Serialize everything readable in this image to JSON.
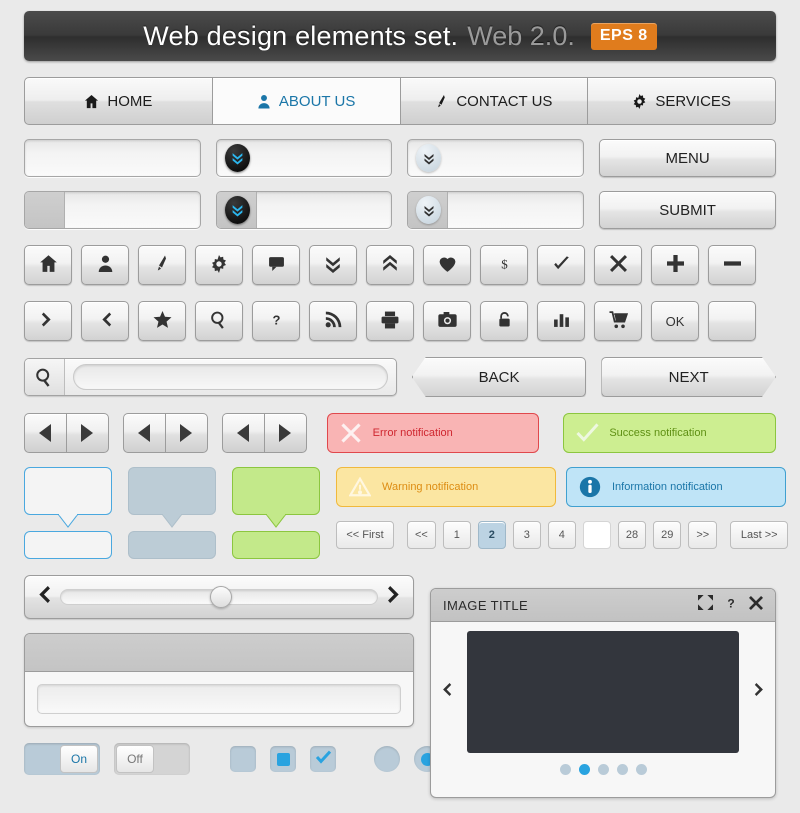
{
  "header": {
    "title": "Web design elements set.",
    "subtitle": "Web 2.0.",
    "badge": "EPS 8",
    "badge_color": "#e07c1d"
  },
  "nav": {
    "items": [
      {
        "label": "HOME",
        "icon": "home-icon",
        "active": false
      },
      {
        "label": "ABOUT US",
        "icon": "user-icon",
        "active": true
      },
      {
        "label": "CONTACT US",
        "icon": "pencil-icon",
        "active": false
      },
      {
        "label": "SERVICES",
        "icon": "gear-icon",
        "active": false
      }
    ],
    "active_color": "#1b76a8"
  },
  "inputs": {
    "row1": {
      "plain_value": "",
      "dark_badge_icon": "double-chevron-down-icon",
      "light_badge_icon": "double-chevron-down-icon",
      "button_label": "MENU"
    },
    "row2": {
      "plain_value": "",
      "dark_badge_icon": "double-chevron-down-icon",
      "light_badge_icon": "double-chevron-down-icon",
      "button_label": "SUBMIT"
    }
  },
  "icon_grid": {
    "row1": [
      "home-icon",
      "user-icon",
      "pencil-icon",
      "gear-icon",
      "comment-icon",
      "double-chevron-down-icon",
      "double-chevron-up-icon",
      "heart-icon",
      "dollar-icon",
      "check-icon",
      "close-icon",
      "plus-icon",
      "minus-icon"
    ],
    "row2": [
      "chevron-right-icon",
      "chevron-left-icon",
      "star-icon",
      "magnifier-icon",
      "question-icon",
      "rss-icon",
      "printer-icon",
      "camera-icon",
      "lock-icon",
      "bar-chart-icon",
      "cart-icon",
      "ok-text-icon",
      "blank-icon"
    ],
    "ok_label": "OK"
  },
  "search": {
    "icon": "magnifier-icon",
    "value": "",
    "placeholder": ""
  },
  "arrow_buttons": {
    "back_label": "BACK",
    "next_label": "NEXT"
  },
  "notifications": [
    {
      "type": "error",
      "label": "Error notification",
      "icon": "x-circle-icon",
      "bg": "#f9b4b4",
      "border": "#e0484c",
      "text": "#cf2730"
    },
    {
      "type": "success",
      "label": "Success notification",
      "icon": "check-icon",
      "bg": "#cdee91",
      "border": "#8cc63f",
      "text": "#5f9014"
    },
    {
      "type": "warning",
      "label": "Warning notification",
      "icon": "warning-triangle-icon",
      "bg": "#fbe6a2",
      "border": "#f0b93c",
      "text": "#dd8d13"
    },
    {
      "type": "info",
      "label": "Information notification",
      "icon": "info-circle-icon",
      "bg": "#bfe4f7",
      "border": "#40a0d0",
      "text": "#1b76a8"
    }
  ],
  "bubbles": [
    {
      "style": "white",
      "body_bg": "#f4f4f4",
      "border": "#4aa8df"
    },
    {
      "style": "gray",
      "body_bg": "#bcccd6",
      "border": "#aebfca"
    },
    {
      "style": "green",
      "body_bg": "#c3e98a",
      "border": "#8cc63f"
    }
  ],
  "pagination": {
    "first_label": "<< First",
    "prev_label": "<<",
    "pages": [
      "1",
      "2",
      "3",
      "4",
      "",
      "28",
      "29"
    ],
    "active_page": "2",
    "next_label": ">>",
    "last_label": "Last >>",
    "active_color": "#bcd3e3"
  },
  "slider": {
    "left_icon": "chevron-left-icon",
    "right_icon": "chevron-right-icon",
    "value_percent": 47
  },
  "panel": {
    "input_value": "",
    "input_placeholder": ""
  },
  "toggles": [
    {
      "state": "on",
      "label": "On"
    },
    {
      "state": "off",
      "label": "Off"
    }
  ],
  "checkboxes": [
    {
      "state": "empty"
    },
    {
      "state": "filled"
    },
    {
      "state": "checked"
    }
  ],
  "radios": [
    {
      "state": "empty"
    },
    {
      "state": "filled"
    },
    {
      "state": "checked"
    }
  ],
  "lightbox": {
    "title": "IMAGE TITLE",
    "actions": [
      "expand-icon",
      "help-icon",
      "close-icon"
    ],
    "prev_icon": "chevron-left-icon",
    "next_icon": "chevron-right-icon",
    "dots_count": 5,
    "active_dot": 2,
    "image_color": "#33363d"
  }
}
